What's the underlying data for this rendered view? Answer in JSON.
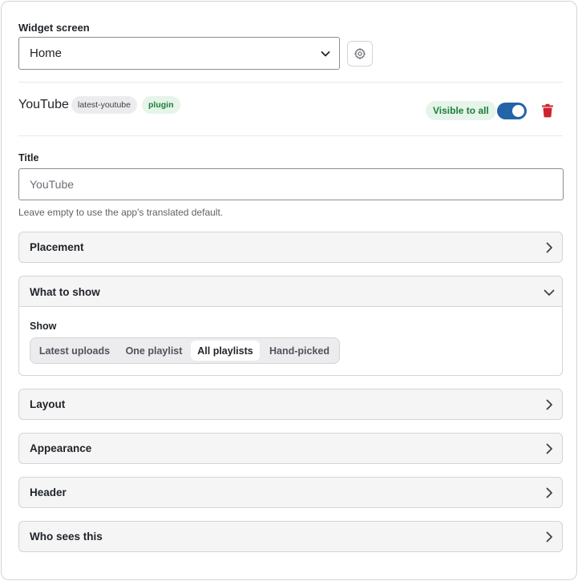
{
  "widget_screen": {
    "label": "Widget screen",
    "selected": "Home"
  },
  "widget": {
    "name": "YouTube",
    "slug": "latest-youtube",
    "type_badge": "plugin",
    "visibility_badge": "Visible to all",
    "enabled": true
  },
  "title_field": {
    "label": "Title",
    "value": "",
    "placeholder": "YouTube",
    "hint": "Leave empty to use the app's translated default."
  },
  "sections": {
    "placement": "Placement",
    "what_to_show": "What to show",
    "layout": "Layout",
    "appearance": "Appearance",
    "header": "Header",
    "who_sees_this": "Who sees this"
  },
  "show": {
    "label": "Show",
    "options": [
      "Latest uploads",
      "One playlist",
      "All playlists",
      "Hand-picked"
    ],
    "selected": "All playlists"
  },
  "colors": {
    "accent": "#2364a8",
    "success_bg": "#e6f4ea",
    "success_text": "#1a7f37",
    "danger": "#cf222e"
  },
  "icons": {
    "screen_settings": "gear-icon",
    "select_caret": "chevron-down-icon",
    "delete": "trash-icon",
    "collapsed": "chevron-right-icon",
    "expanded": "chevron-down-icon"
  }
}
